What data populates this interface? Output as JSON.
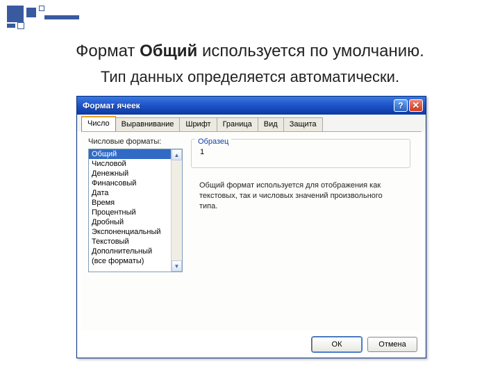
{
  "headline": {
    "pre": "Формат ",
    "bold": "Общий",
    "post": " используется по умолчанию."
  },
  "subhead": "Тип данных определяется автоматически.",
  "titlebar": {
    "title": "Формат ячеек",
    "help": "?",
    "close": "✕"
  },
  "tabs": [
    "Число",
    "Выравнивание",
    "Шрифт",
    "Граница",
    "Вид",
    "Защита"
  ],
  "formats_label": "Числовые форматы:",
  "formats": [
    "Общий",
    "Числовой",
    "Денежный",
    "Финансовый",
    "Дата",
    "Время",
    "Процентный",
    "Дробный",
    "Экспоненциальный",
    "Текстовый",
    "Дополнительный",
    "(все форматы)"
  ],
  "sample_label": "Образец",
  "sample_value": "1",
  "description": "Общий формат используется для отображения как текстовых, так и числовых значений произвольного типа.",
  "buttons": {
    "ok": "ОК",
    "cancel": "Отмена"
  },
  "scroll": {
    "up": "▲",
    "down": "▼"
  }
}
